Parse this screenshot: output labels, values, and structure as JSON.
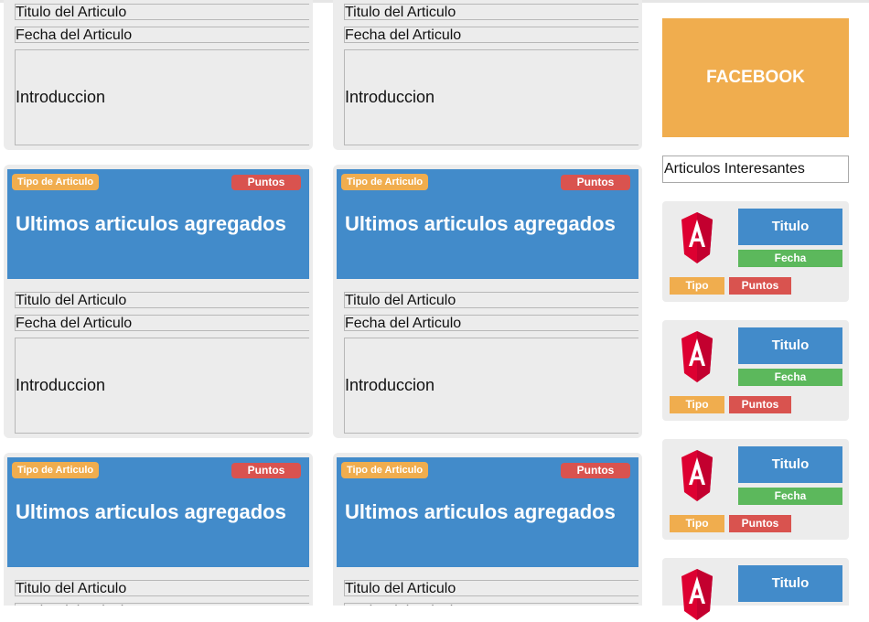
{
  "article_card": {
    "type_label": "Tipo de Articulo",
    "points_label": "Puntos",
    "headline": "Ultimos articulos agregados",
    "title_field": "Titulo del Articulo",
    "date_field": "Fecha del Articulo",
    "intro_field": "Introduccion"
  },
  "sidebar": {
    "facebook_label": "FACEBOOK",
    "search_value": "Articulos Interesantes",
    "item": {
      "icon": "angular-logo-icon",
      "title_label": "Titulo",
      "date_label": "Fecha",
      "type_label": "Tipo",
      "points_label": "Puntos"
    }
  },
  "colors": {
    "banner": "#428bca",
    "type_badge": "#f0ad4e",
    "points_badge": "#d9534f",
    "date_badge": "#5cb85c",
    "card_bg": "#ececec",
    "angular_red": "#dd0031"
  }
}
